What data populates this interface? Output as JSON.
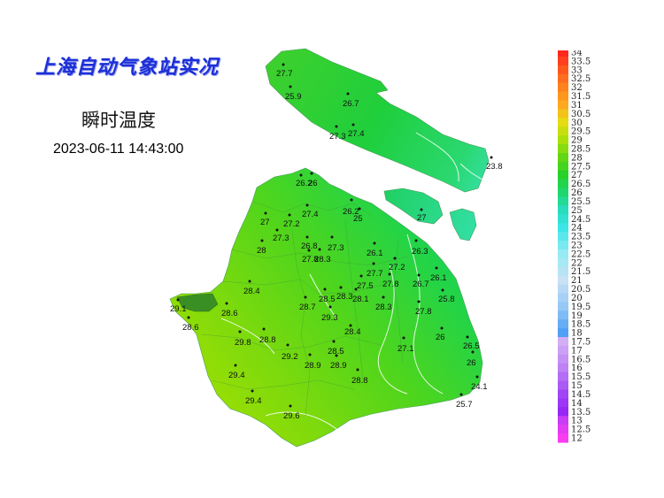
{
  "header": {
    "agency_title": "上海自动气象站实况",
    "variable": "瞬时温度",
    "timestamp": "2023-06-11 14:43:00"
  },
  "map": {
    "stations": [
      {
        "label": "27.7",
        "value": 27.7
      },
      {
        "label": "25.9",
        "value": 25.9
      },
      {
        "label": "26.7",
        "value": 26.7
      },
      {
        "label": "27.3",
        "value": 27.3
      },
      {
        "label": "27.4",
        "value": 27.4
      },
      {
        "label": "23.8",
        "value": 23.8
      },
      {
        "label": "26.2",
        "value": 26.2
      },
      {
        "label": "26",
        "value": 26
      },
      {
        "label": "27.4",
        "value": 27.4
      },
      {
        "label": "26.2",
        "value": 26.2
      },
      {
        "label": "25",
        "value": 25
      },
      {
        "label": "27",
        "value": 27
      },
      {
        "label": "27",
        "value": 27
      },
      {
        "label": "27.2",
        "value": 27.2
      },
      {
        "label": "27.3",
        "value": 27.3
      },
      {
        "label": "26.8",
        "value": 26.8
      },
      {
        "label": "27.3",
        "value": 27.3
      },
      {
        "label": "28",
        "value": 28
      },
      {
        "label": "27.8",
        "value": 27.8
      },
      {
        "label": "28.3",
        "value": 28.3
      },
      {
        "label": "26.1",
        "value": 26.1
      },
      {
        "label": "26.3",
        "value": 26.3
      },
      {
        "label": "27.2",
        "value": 27.2
      },
      {
        "label": "27.7",
        "value": 27.7
      },
      {
        "label": "27.5",
        "value": 27.5
      },
      {
        "label": "27.8",
        "value": 27.8
      },
      {
        "label": "26.7",
        "value": 26.7
      },
      {
        "label": "26.1",
        "value": 26.1
      },
      {
        "label": "28.4",
        "value": 28.4
      },
      {
        "label": "28.5",
        "value": 28.5
      },
      {
        "label": "28.3",
        "value": 28.3
      },
      {
        "label": "28.1",
        "value": 28.1
      },
      {
        "label": "25.8",
        "value": 25.8
      },
      {
        "label": "29.1",
        "value": 29.1
      },
      {
        "label": "28.6",
        "value": 28.6
      },
      {
        "label": "28.7",
        "value": 28.7
      },
      {
        "label": "29.3",
        "value": 29.3
      },
      {
        "label": "28.3",
        "value": 28.3
      },
      {
        "label": "27.8",
        "value": 27.8
      },
      {
        "label": "28.6",
        "value": 28.6
      },
      {
        "label": "28.4",
        "value": 28.4
      },
      {
        "label": "26",
        "value": 26
      },
      {
        "label": "29.8",
        "value": 29.8
      },
      {
        "label": "28.8",
        "value": 28.8
      },
      {
        "label": "27.1",
        "value": 27.1
      },
      {
        "label": "26.5",
        "value": 26.5
      },
      {
        "label": "29.2",
        "value": 29.2
      },
      {
        "label": "28.5",
        "value": 28.5
      },
      {
        "label": "28.9",
        "value": 28.9
      },
      {
        "label": "28.9",
        "value": 28.9
      },
      {
        "label": "26",
        "value": 26
      },
      {
        "label": "29.4",
        "value": 29.4
      },
      {
        "label": "28.8",
        "value": 28.8
      },
      {
        "label": "24.1",
        "value": 24.1
      },
      {
        "label": "29.4",
        "value": 29.4
      },
      {
        "label": "25.7",
        "value": 25.7
      },
      {
        "label": "29.6",
        "value": 29.6
      }
    ]
  },
  "legend": {
    "unit_range": [
      12,
      34
    ],
    "labels": [
      "34",
      "33.5",
      "33",
      "32.5",
      "32",
      "31.5",
      "31",
      "30.5",
      "30",
      "29.5",
      "29",
      "28.5",
      "28",
      "27.5",
      "27",
      "26.5",
      "26",
      "25.5",
      "25",
      "24.5",
      "24",
      "23.5",
      "23",
      "22.5",
      "22",
      "21.5",
      "21",
      "20.5",
      "20",
      "19.5",
      "19",
      "18.5",
      "18",
      "17.5",
      "17",
      "16.5",
      "16",
      "15.5",
      "15",
      "14.5",
      "14",
      "13.5",
      "13",
      "12.5",
      "12"
    ]
  }
}
